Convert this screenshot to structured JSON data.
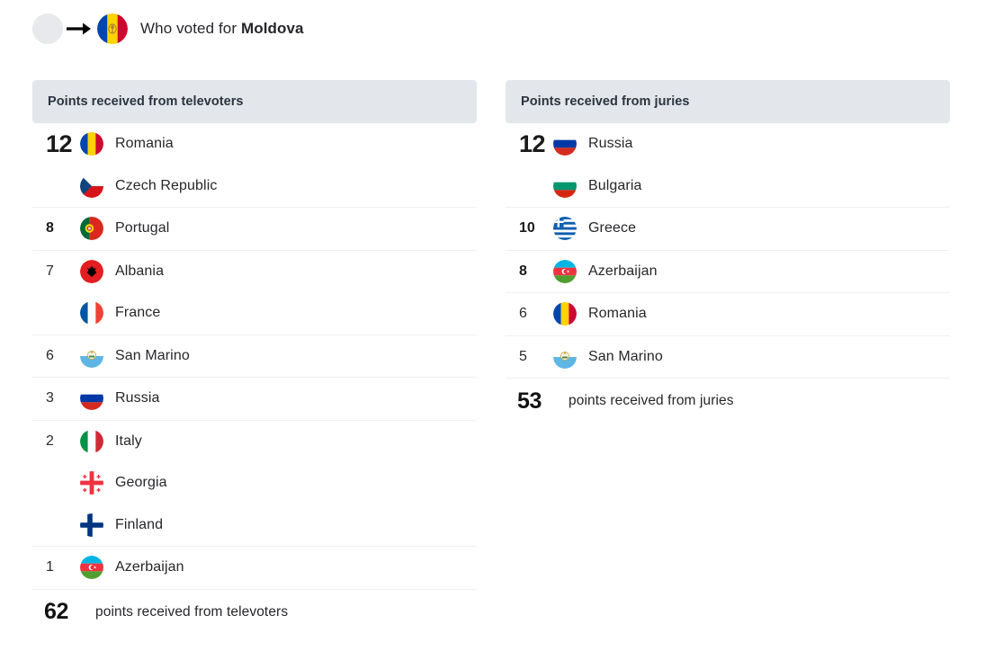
{
  "header": {
    "placeholder_icon": "empty-circle",
    "arrow_icon": "arrow-right-icon",
    "target_flag": "moldova-flag",
    "text_prefix": "Who voted for ",
    "target_country": "Moldova"
  },
  "colors": {
    "column_header_bg": "#e3e6ea",
    "column_header_text": "#2b3440",
    "divider": "#f0f0f1",
    "page_bg": "#ffffff",
    "body_text": "#27272b"
  },
  "columns": [
    {
      "id": "televoters",
      "title": "Points received from televoters",
      "groups": [
        {
          "score": "12",
          "score_style": "big",
          "entries": [
            {
              "country": "Romania",
              "flag": "romania-flag"
            },
            {
              "country": "Czech Republic",
              "flag": "czech-republic-flag"
            }
          ]
        },
        {
          "score": "8",
          "score_style": "bold",
          "entries": [
            {
              "country": "Portugal",
              "flag": "portugal-flag"
            }
          ]
        },
        {
          "score": "7",
          "score_style": "normal",
          "entries": [
            {
              "country": "Albania",
              "flag": "albania-flag"
            },
            {
              "country": "France",
              "flag": "france-flag"
            }
          ]
        },
        {
          "score": "6",
          "score_style": "normal",
          "entries": [
            {
              "country": "San Marino",
              "flag": "san-marino-flag"
            }
          ]
        },
        {
          "score": "3",
          "score_style": "normal",
          "entries": [
            {
              "country": "Russia",
              "flag": "russia-flag"
            }
          ]
        },
        {
          "score": "2",
          "score_style": "normal",
          "entries": [
            {
              "country": "Italy",
              "flag": "italy-flag"
            },
            {
              "country": "Georgia",
              "flag": "georgia-flag"
            },
            {
              "country": "Finland",
              "flag": "finland-flag"
            }
          ]
        },
        {
          "score": "1",
          "score_style": "normal",
          "entries": [
            {
              "country": "Azerbaijan",
              "flag": "azerbaijan-flag"
            }
          ]
        }
      ],
      "total": {
        "value": "62",
        "label": "points received from televoters"
      }
    },
    {
      "id": "juries",
      "title": "Points received from juries",
      "groups": [
        {
          "score": "12",
          "score_style": "big",
          "entries": [
            {
              "country": "Russia",
              "flag": "russia-flag"
            },
            {
              "country": "Bulgaria",
              "flag": "bulgaria-flag"
            }
          ]
        },
        {
          "score": "10",
          "score_style": "bold",
          "entries": [
            {
              "country": "Greece",
              "flag": "greece-flag"
            }
          ]
        },
        {
          "score": "8",
          "score_style": "bold",
          "entries": [
            {
              "country": "Azerbaijan",
              "flag": "azerbaijan-flag"
            }
          ]
        },
        {
          "score": "6",
          "score_style": "normal",
          "entries": [
            {
              "country": "Romania",
              "flag": "romania-flag"
            }
          ]
        },
        {
          "score": "5",
          "score_style": "normal",
          "entries": [
            {
              "country": "San Marino",
              "flag": "san-marino-flag"
            }
          ]
        }
      ],
      "total": {
        "value": "53",
        "label": "points received from juries"
      }
    }
  ]
}
